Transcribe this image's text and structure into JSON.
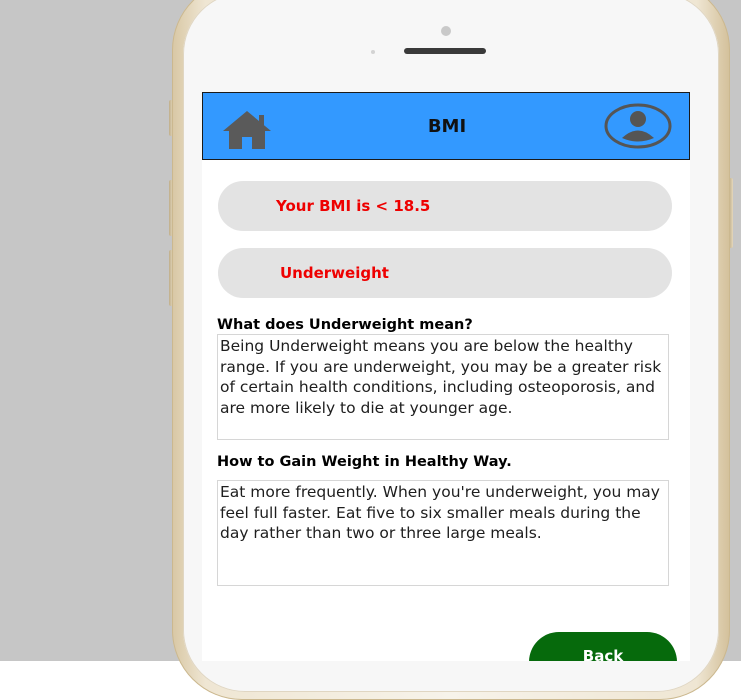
{
  "header": {
    "title": "BMI",
    "home_icon": "home-icon",
    "profile_icon": "user-profile-icon",
    "bar_color": "#3399ff"
  },
  "result": {
    "bmi_text": "Your BMI is < 18.5",
    "category": "Underweight",
    "highlight_color": "#ee0000"
  },
  "sections": [
    {
      "heading": "What does Underweight mean?",
      "body": "Being Underweight means you are below the healthy range. If you are underweight, you may be a greater risk of certain health conditions, including osteoporosis, and are more likely to die at younger age."
    },
    {
      "heading": "How to Gain Weight in Healthy Way.",
      "body": "Eat more frequently. When you're underweight, you may feel full faster. Eat five to six smaller meals during the day rather than two or three large meals."
    }
  ],
  "actions": {
    "back_label": "Back",
    "back_color": "#066a0c"
  }
}
